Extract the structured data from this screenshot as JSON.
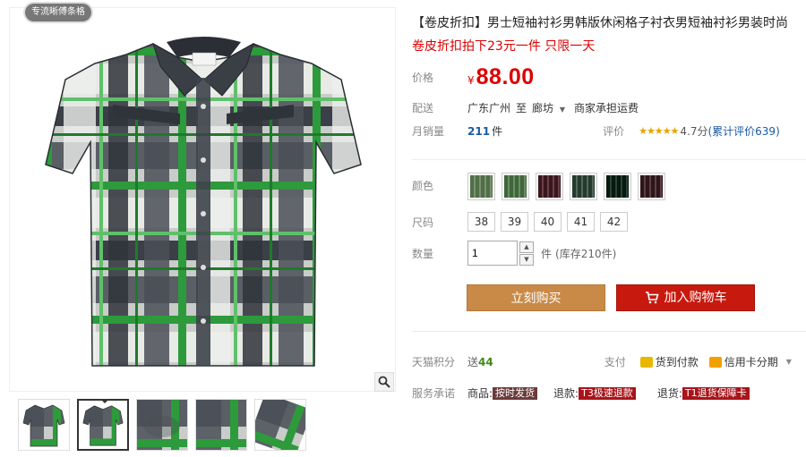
{
  "gallery": {
    "shop_tag": "专流晰傅条格",
    "thumb_count": 5
  },
  "product": {
    "title": "【卷皮折扣】男士短袖衬衫男韩版休闲格子衬衣男短袖衬衫男装时尚",
    "subtitle": "卷皮折扣拍下23元一件 只限一天",
    "price_label": "价格",
    "currency": "¥",
    "price": "88.00",
    "delivery_label": "配送",
    "delivery_from": "广东广州",
    "delivery_to_word": "至",
    "delivery_to": "廊坊",
    "shipping_note": "商家承担运费",
    "sales_label": "月销量",
    "sales_count": "211",
    "sales_unit": "件",
    "rating_label": "评价",
    "stars": "★★★★★",
    "rating_score": "4.7分",
    "rating_count": "(累计评价639)"
  },
  "options": {
    "color_label": "颜色",
    "colors": [
      "#8fa886",
      "#7fa27a",
      "#7b4b55",
      "#5f7a6a",
      "#2f5040",
      "#6b4a50"
    ],
    "size_label": "尺码",
    "sizes": [
      "38",
      "39",
      "40",
      "41",
      "42"
    ],
    "qty_label": "数量",
    "qty_value": "1",
    "qty_up": "▲",
    "qty_down": "▼",
    "stock_unit": "件",
    "stock_text": "(库存210件)"
  },
  "actions": {
    "buy_label": "立刻购买",
    "cart_label": "加入购物车"
  },
  "extras": {
    "points_label": "天猫积分",
    "points_prefix": "送",
    "points_value": "44",
    "pay_label": "支付",
    "cod_label": "货到付款",
    "installment_label": "信用卡分期",
    "service_label": "服务承诺",
    "svc1_prefix": "商品:",
    "svc1_badge": "按时发货",
    "svc2_prefix": "退款:",
    "svc2_badge": "T3极速退款",
    "svc3_prefix": "退货:",
    "svc3_badge": "T1退货保障卡"
  }
}
